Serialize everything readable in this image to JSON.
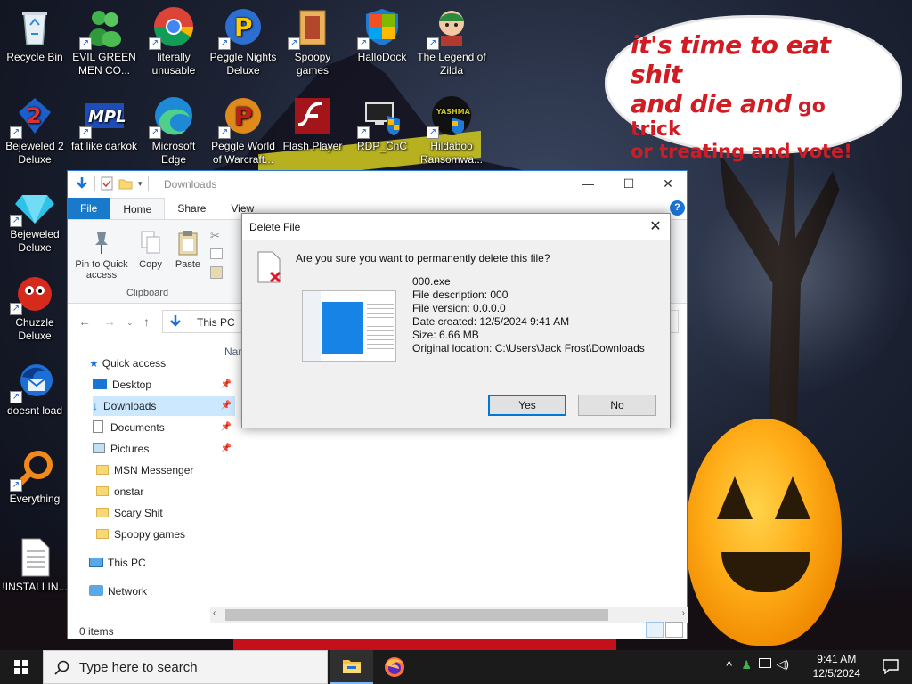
{
  "speech_bubble": {
    "line1": "it's time to eat shit",
    "line2a": "and die and",
    "line2b": " go trick",
    "line3": "or treating and vote!"
  },
  "desktop_icons": [
    {
      "label": "Recycle Bin"
    },
    {
      "label": "EVIL GREEN MEN CO..."
    },
    {
      "label": "literally unusable"
    },
    {
      "label": "Peggle Nights Deluxe"
    },
    {
      "label": "Spoopy games"
    },
    {
      "label": "HalloDock"
    },
    {
      "label": "The Legend of Zilda"
    },
    {
      "label": "Bejeweled 2 Deluxe"
    },
    {
      "label": "fat like darkok"
    },
    {
      "label": "Microsoft Edge"
    },
    {
      "label": "Peggle World of Warcraft..."
    },
    {
      "label": "Flash Player"
    },
    {
      "label": "RDP_CnC"
    },
    {
      "label": "Hildaboo Ransomwa..."
    },
    {
      "label": "Bejeweled Deluxe"
    },
    {
      "label": "Chuzzle Deluxe"
    },
    {
      "label": "doesnt load"
    },
    {
      "label": "Everything"
    },
    {
      "label": "!INSTALLIN..."
    }
  ],
  "explorer": {
    "title": "Downloads",
    "tabs": {
      "file": "File",
      "home": "Home",
      "share": "Share",
      "view": "View"
    },
    "ribbon": {
      "pin": "Pin to Quick access",
      "copy": "Copy",
      "paste": "Paste",
      "group": "Clipboard"
    },
    "address": "This PC",
    "column_header": "Nam",
    "nav": {
      "quick_access": "Quick access",
      "desktop": "Desktop",
      "downloads": "Downloads",
      "documents": "Documents",
      "pictures": "Pictures",
      "msn": "MSN Messenger",
      "onstar": "onstar",
      "scary": "Scary Shit",
      "spoopy": "Spoopy games",
      "this_pc": "This PC",
      "network": "Network"
    },
    "status": "0 items"
  },
  "dialog": {
    "title": "Delete File",
    "question": "Are you sure you want to permanently delete this file?",
    "filename": "000.exe",
    "description": "File description: 000",
    "version": "File version: 0.0.0.0",
    "created": "Date created: 12/5/2024 9:41 AM",
    "size": "Size: 6.66 MB",
    "location": "Original location: C:\\Users\\Jack Frost\\Downloads",
    "yes": "Yes",
    "no": "No"
  },
  "taskbar": {
    "search_placeholder": "Type here to search",
    "time": "9:41 AM",
    "date": "12/5/2024"
  },
  "colors": {
    "accent": "#0078d7",
    "file_tab": "#1979ca",
    "speech_text": "#d11c24"
  }
}
